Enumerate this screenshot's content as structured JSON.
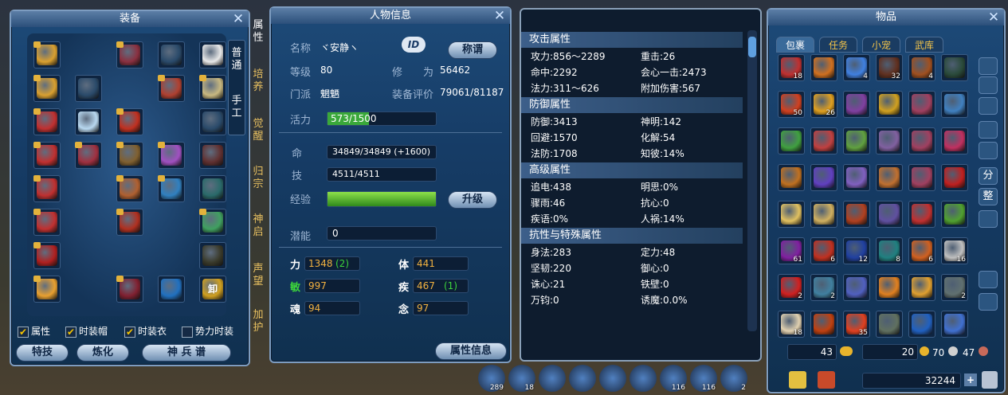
{
  "equip": {
    "title": "装备",
    "tabs": [
      "属性",
      "培养",
      "觉醒",
      "归宗",
      "神启",
      "声望",
      "加护"
    ],
    "mode": [
      "普通",
      "手工"
    ],
    "checks": [
      {
        "label": "属性",
        "on": true
      },
      {
        "label": "时装帽",
        "on": true
      },
      {
        "label": "时装衣",
        "on": true
      },
      {
        "label": "势力时装",
        "on": false
      }
    ],
    "buttons": [
      "特技",
      "炼化",
      "神 兵 谱"
    ],
    "unload": "卸"
  },
  "char": {
    "title": "人物信息",
    "name_label": "名称",
    "name": "ヾ安静ヽ",
    "id_btn": "ID",
    "title_btn": "称谓",
    "level_label": "等级",
    "level": "80",
    "cult_label": "修　　为",
    "cult": "56462",
    "sect_label": "门派",
    "sect": "魍魉",
    "rating_label": "装备评价",
    "rating": "79061/81187",
    "vigor_label": "活力",
    "vigor": "573/1500",
    "vigor_frac": 0.382,
    "life_label": "命",
    "life": "34849/34849 (+1600)",
    "skill_label": "技",
    "skill": "4511/4511",
    "exp_label": "经验",
    "exp_frac": 1.0,
    "upgrade_btn": "升级",
    "potential_label": "潜能",
    "potential": "0",
    "attrs": [
      {
        "k": "力",
        "v": "1348",
        "b": "(2)"
      },
      {
        "k": "体",
        "v": "441",
        "b": ""
      },
      {
        "k": "敏",
        "v": "997",
        "b": ""
      },
      {
        "k": "疾",
        "v": "467",
        "b": "(1)"
      },
      {
        "k": "魂",
        "v": "94",
        "b": ""
      },
      {
        "k": "念",
        "v": "97",
        "b": ""
      }
    ],
    "info_btn": "属性信息"
  },
  "stats": {
    "sections": [
      {
        "title": "攻击属性",
        "rows": [
          [
            "攻力:856～2289",
            "重击:26"
          ],
          [
            "命中:2292",
            "会心一击:2473"
          ],
          [
            "法力:311～626",
            "附加伤害:567"
          ]
        ]
      },
      {
        "title": "防御属性",
        "rows": [
          [
            "防御:3413",
            "神明:142"
          ],
          [
            "回避:1570",
            "化解:54"
          ],
          [
            "法防:1708",
            "知彼:14%"
          ]
        ]
      },
      {
        "title": "高级属性",
        "rows": [
          [
            "追电:438",
            "明思:0%"
          ],
          [
            "骤雨:46",
            "抗心:0"
          ],
          [
            "疾语:0%",
            "人祸:14%"
          ]
        ]
      },
      {
        "title": "抗性与特殊属性",
        "rows": [
          [
            "身法:283",
            "定力:48"
          ],
          [
            "坚韧:220",
            "御心:0"
          ],
          [
            "诛心:21",
            "铁壁:0"
          ],
          [
            "万钧:0",
            "诱魔:0.0%"
          ]
        ]
      }
    ]
  },
  "bag": {
    "title": "物品",
    "tabs": [
      "包裹",
      "任务",
      "小宠",
      "武库"
    ],
    "side": [
      "分",
      "整"
    ],
    "counts": [
      "18",
      "",
      "4",
      "32",
      "4",
      "",
      "50",
      "26",
      "",
      "",
      "",
      "",
      "",
      "",
      "",
      "",
      "",
      "",
      "",
      "",
      "",
      "",
      "",
      "",
      "",
      "",
      "",
      "",
      "",
      "",
      "61",
      "6",
      "12",
      "8",
      "6",
      "16",
      "2",
      "2",
      "",
      "",
      "",
      "2",
      "18",
      "",
      "35",
      "",
      "",
      "",
      "10",
      "3",
      "",
      "",
      "",
      ""
    ],
    "money1": "43",
    "money2": "20",
    "money3": "70",
    "money4": "47",
    "money5": "32244"
  },
  "hotbar": [
    "289",
    "18",
    "116",
    "116",
    "2"
  ]
}
